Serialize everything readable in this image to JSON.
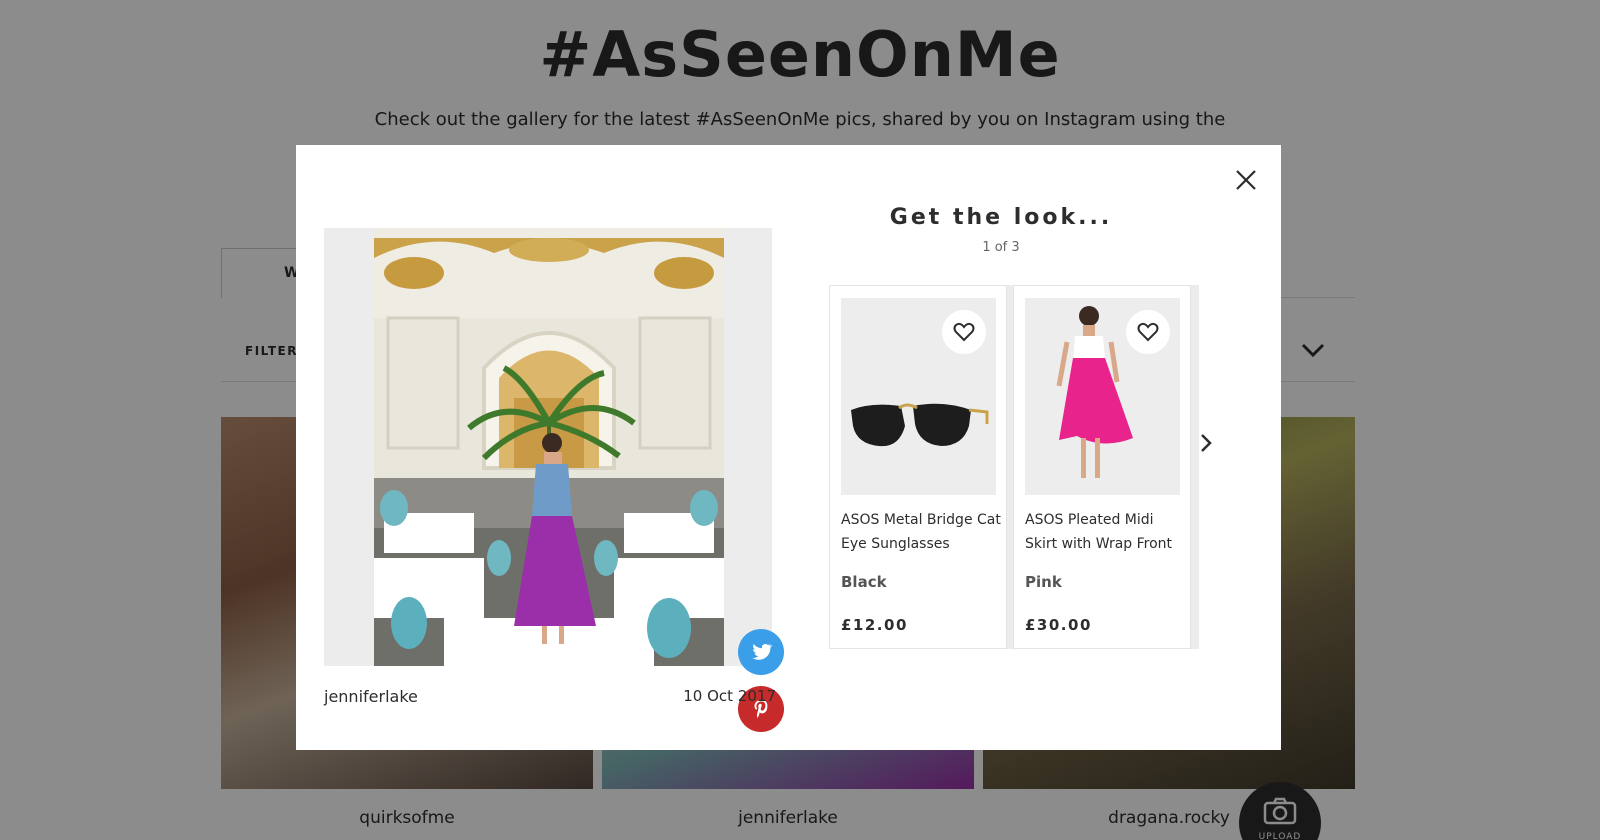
{
  "page": {
    "title": "#AsSeenOnMe",
    "intro_line1": "Check out the gallery for the latest #AsSeenOnMe pics, shared by you on Instagram using the",
    "tab_active_label": "W",
    "filter_label": "FILTER",
    "gallery_captions": [
      "quirksofme",
      "jenniferlake",
      "dragana.rocky"
    ],
    "upload_label": "UPLOAD"
  },
  "modal": {
    "photo_user": "jenniferlake",
    "photo_date": "10 Oct 2017",
    "look_title": "Get the look...",
    "look_count": "1 of 3",
    "products": [
      {
        "name": "ASOS Metal Bridge Cat Eye Sunglasses",
        "colour": "Black",
        "price": "£12.00"
      },
      {
        "name": "ASOS Pleated Midi Skirt with Wrap Front",
        "colour": "Pink",
        "price": "£30.00"
      }
    ]
  },
  "colors": {
    "twitter": "#3a9ee8",
    "pinterest": "#c62a2a",
    "text": "#2d2d2d",
    "skirt_magenta": "#9a2fa9",
    "skirt_pink": "#e8238c"
  },
  "icons": [
    "close-icon",
    "twitter-icon",
    "pinterest-icon",
    "heart-icon",
    "chevron-right-icon",
    "chevron-down-icon",
    "camera-icon"
  ]
}
